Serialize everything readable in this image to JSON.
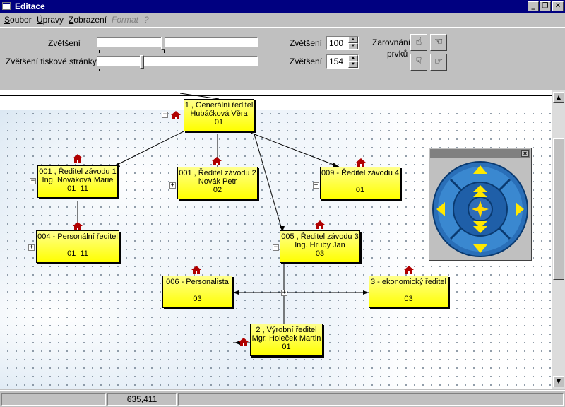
{
  "window": {
    "title": "Editace",
    "buttons": [
      "_",
      "❐",
      "✕"
    ]
  },
  "menu": {
    "items": [
      {
        "label": "Soubor",
        "accel": "S",
        "rest": "oubor",
        "enabled": true
      },
      {
        "label": "Úpravy",
        "accel": "Ú",
        "rest": "pravy",
        "enabled": true
      },
      {
        "label": "Zobrazení",
        "accel": "Z",
        "rest": "obrazení",
        "enabled": true
      },
      {
        "label": "Format",
        "accel": "",
        "rest": "Format",
        "enabled": false
      },
      {
        "label": "?",
        "accel": "",
        "rest": "?",
        "enabled": false
      }
    ]
  },
  "toolbar": {
    "zoom_label": "Zvětšení",
    "print_zoom_label": "Zvětšení tiskové stránky",
    "zoom_spin_label": "Zvětšení",
    "zoom_value": "100",
    "print_zoom_spin_label": "Zvětšení",
    "print_zoom_value": "154",
    "align_label_1": "Zarovnání",
    "align_label_2": "prvků"
  },
  "org": {
    "nodes": [
      {
        "id": "gen",
        "lines": [
          "1 , Generální ředitel",
          "Hubáčková Věra",
          "01"
        ]
      },
      {
        "id": "z1",
        "lines": [
          "001 , Ředitel závodu 1",
          "Ing. Nováková Marie",
          "01  11"
        ]
      },
      {
        "id": "z2",
        "lines": [
          "001 , Ředitel závodu 2",
          "Novák Petr",
          "02"
        ]
      },
      {
        "id": "z4",
        "lines": [
          "009 - Ředitel závodu 4",
          "",
          "01"
        ]
      },
      {
        "id": "pers",
        "lines": [
          "004 - Personální ředitel",
          "",
          "01  11"
        ]
      },
      {
        "id": "z3",
        "lines": [
          "005 , Ředitel závodu 3",
          "Ing. Hruby Jan",
          "03"
        ]
      },
      {
        "id": "psn",
        "lines": [
          "006 - Personalista",
          "",
          "03"
        ]
      },
      {
        "id": "eko",
        "lines": [
          "3 - ekonomický ředitel",
          "",
          "03"
        ]
      },
      {
        "id": "vyr",
        "lines": [
          "2 , Výrobní ředitel",
          "Mgr. Holeček Martin",
          "01"
        ]
      }
    ]
  },
  "status": {
    "coords": "635,411"
  }
}
